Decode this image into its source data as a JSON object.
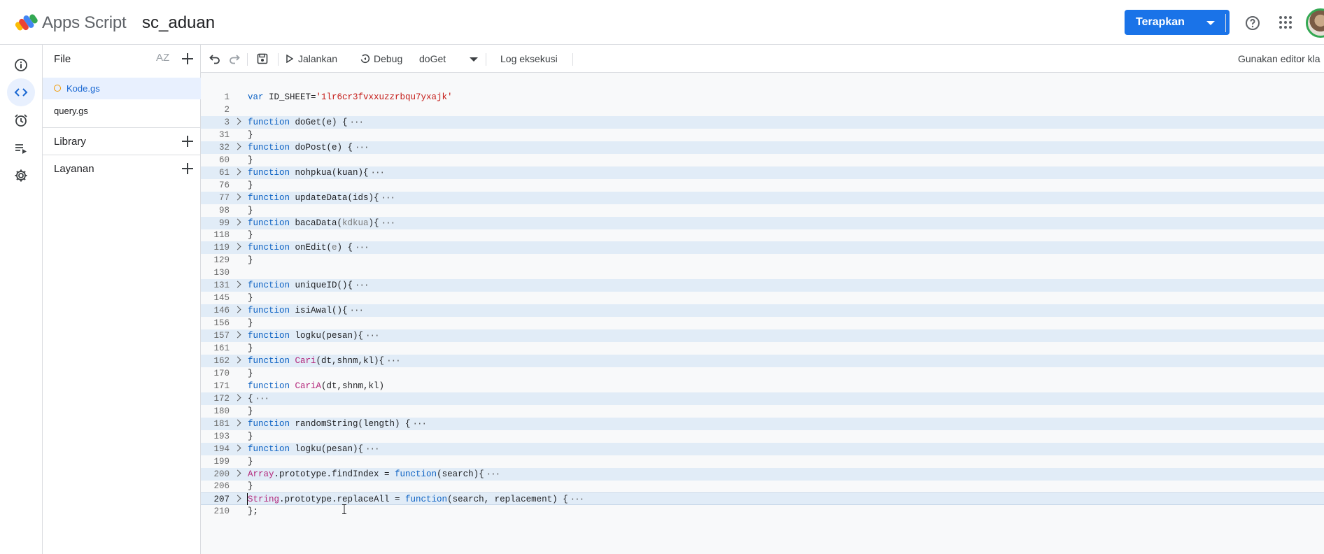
{
  "header": {
    "app_name": "Apps Script",
    "project_name": "sc_aduan",
    "deploy_label": "Terapkan"
  },
  "rail": {
    "items": [
      "info-icon",
      "code-icon",
      "triggers-icon",
      "executions-icon",
      "settings-icon"
    ],
    "active": "code-icon"
  },
  "files": {
    "title": "File",
    "sort_label": "AZ",
    "items": [
      {
        "name": "Kode.gs",
        "active": true,
        "unsaved": true
      },
      {
        "name": "query.gs",
        "active": false
      }
    ],
    "sections": [
      {
        "label": "Library"
      },
      {
        "label": "Layanan"
      }
    ]
  },
  "toolbar": {
    "run_label": "Jalankan",
    "debug_label": "Debug",
    "function_select": "doGet",
    "log_label": "Log eksekusi",
    "classic_editor_label": "Gunakan editor kla"
  },
  "editor": {
    "lines": [
      {
        "n": "1",
        "text": "var ID_SHEET='1lr6cr3fvxxuzzrbqu7yxajk'",
        "fold": false
      },
      {
        "n": "2",
        "text": "",
        "fold": false
      },
      {
        "n": "3",
        "text": "function doGet(e) {",
        "fold": true
      },
      {
        "n": "31",
        "text": "}",
        "fold": false
      },
      {
        "n": "32",
        "text": "function doPost(e) {",
        "fold": true
      },
      {
        "n": "60",
        "text": "}",
        "fold": false
      },
      {
        "n": "61",
        "text": "function nohpkua(kuan){",
        "fold": true
      },
      {
        "n": "76",
        "text": "}",
        "fold": false
      },
      {
        "n": "77",
        "text": "function updateData(ids){",
        "fold": true
      },
      {
        "n": "98",
        "text": "}",
        "fold": false
      },
      {
        "n": "99",
        "text": "function bacaData(kdkua){",
        "fold": true
      },
      {
        "n": "118",
        "text": "}",
        "fold": false
      },
      {
        "n": "119",
        "text": "function onEdit(e) {",
        "fold": true
      },
      {
        "n": "129",
        "text": "}",
        "fold": false
      },
      {
        "n": "130",
        "text": "",
        "fold": false
      },
      {
        "n": "131",
        "text": "function uniqueID(){",
        "fold": true
      },
      {
        "n": "145",
        "text": "}",
        "fold": false
      },
      {
        "n": "146",
        "text": "function isiAwal(){",
        "fold": true
      },
      {
        "n": "156",
        "text": "}",
        "fold": false
      },
      {
        "n": "157",
        "text": "function logku(pesan){",
        "fold": true
      },
      {
        "n": "161",
        "text": "}",
        "fold": false
      },
      {
        "n": "162",
        "text": "function Cari(dt,shnm,kl){",
        "fold": true
      },
      {
        "n": "170",
        "text": "}",
        "fold": false
      },
      {
        "n": "171",
        "text": "function CariA(dt,shnm,kl)",
        "fold": false
      },
      {
        "n": "172",
        "text": "{",
        "fold": true
      },
      {
        "n": "180",
        "text": "}",
        "fold": false
      },
      {
        "n": "181",
        "text": "function randomString(length) {",
        "fold": true
      },
      {
        "n": "193",
        "text": "}",
        "fold": false
      },
      {
        "n": "194",
        "text": "function logku(pesan){",
        "fold": true
      },
      {
        "n": "199",
        "text": "}",
        "fold": false
      },
      {
        "n": "200",
        "text": "Array.prototype.findIndex = function(search){",
        "fold": true
      },
      {
        "n": "206",
        "text": "}",
        "fold": false
      },
      {
        "n": "207",
        "text": "String.prototype.replaceAll = function(search, replacement) {",
        "fold": true,
        "current": true
      },
      {
        "n": "210",
        "text": "};",
        "fold": false
      }
    ]
  },
  "colors": {
    "accent": "#1a73e8",
    "fold_bg": "#e1ecf7",
    "keyword": "#0b61c3",
    "class": "#b3267a",
    "string": "#c41a16"
  }
}
